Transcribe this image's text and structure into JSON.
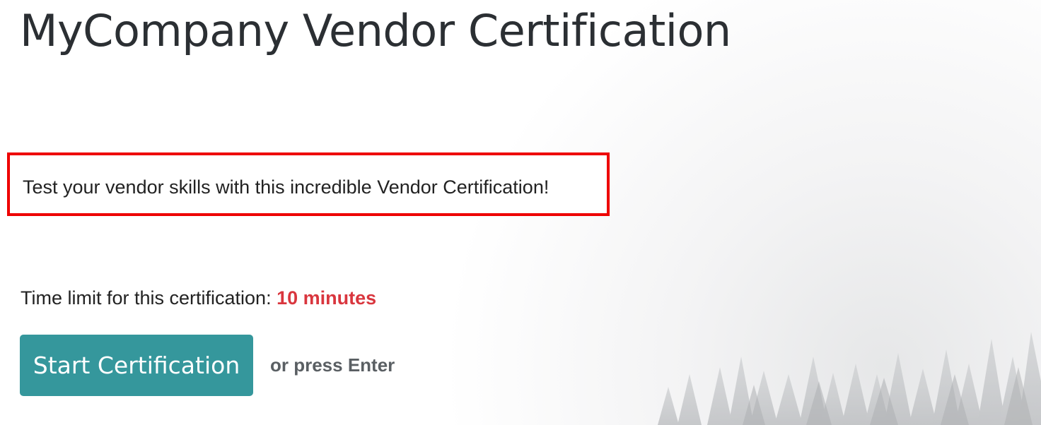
{
  "survey": {
    "title": "MyCompany Vendor Certification",
    "description": "Test your vendor skills with this incredible Vendor Certification!",
    "time_limit_label": "Time limit for this certification:",
    "time_limit_value": "10 minutes",
    "start_button_label": "Start Certification",
    "press_hint": "or press Enter"
  },
  "colors": {
    "accent_button": "#35979c",
    "time_value": "#d9363e",
    "highlight_border": "#ee0000"
  }
}
